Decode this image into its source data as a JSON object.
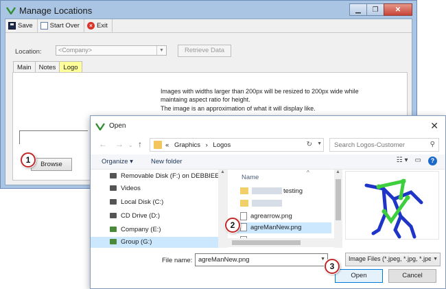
{
  "main_window": {
    "title": "Manage Locations",
    "toolbar": {
      "save_label": "Save",
      "start_over_label": "Start Over",
      "exit_label": "Exit"
    },
    "location_label": "Location:",
    "location_value": "<Company>",
    "retrieve_button": "Retrieve Data",
    "tabs": [
      {
        "label": "Main"
      },
      {
        "label": "Notes"
      },
      {
        "label": "Logo"
      }
    ],
    "active_tab": "Logo",
    "logo_info_line1": "Images with widths larger than 200px will be resized to 200px wide while maintaing aspect ratio for height.",
    "logo_info_line2": "The image is an approximation of what it will display like.",
    "browse_button": "Browse",
    "window_buttons": [
      "minimize",
      "restore",
      "close"
    ]
  },
  "open_dialog": {
    "title": "Open",
    "close_glyph": "✕",
    "breadcrumb": [
      "«",
      "Graphics",
      "›",
      "Logos"
    ],
    "search_placeholder": "Search Logos-Customer",
    "organize_label": "Organize ▾",
    "new_folder_label": "New folder",
    "nav_items": [
      {
        "label": "Removable Disk (F:) on DEBBIEE-PC",
        "icon": "usb-drive-icon"
      },
      {
        "label": "Videos",
        "icon": "videos-icon"
      },
      {
        "label": "Local Disk (C:)",
        "icon": "disk-icon"
      },
      {
        "label": "CD Drive (D:)",
        "icon": "cd-drive-icon"
      },
      {
        "label": "Company (E:)",
        "icon": "network-drive-icon"
      },
      {
        "label": "Group (G:)",
        "icon": "network-drive-icon"
      }
    ],
    "column_header": "Name",
    "files": [
      {
        "name": "testing",
        "type": "folder"
      },
      {
        "name": "",
        "type": "folder"
      },
      {
        "name": "agrearrow.png",
        "type": "image"
      },
      {
        "name": "agreManNew.png",
        "type": "image"
      },
      {
        "name": "",
        "type": "image"
      }
    ],
    "selected_file": "agreManNew.png",
    "file_name_label": "File name:",
    "file_name_value": "agreManNew.png",
    "file_type_value": "Image Files (*.jpeg, *.jpg, *.jpe,",
    "open_button": "Open",
    "cancel_button": "Cancel"
  },
  "callouts": [
    "1",
    "2",
    "3"
  ],
  "colors": {
    "accent_blue": "#0078d7",
    "active_tab": "#ffff9a",
    "callout_ring": "#c22727",
    "selection": "#cce8ff"
  }
}
